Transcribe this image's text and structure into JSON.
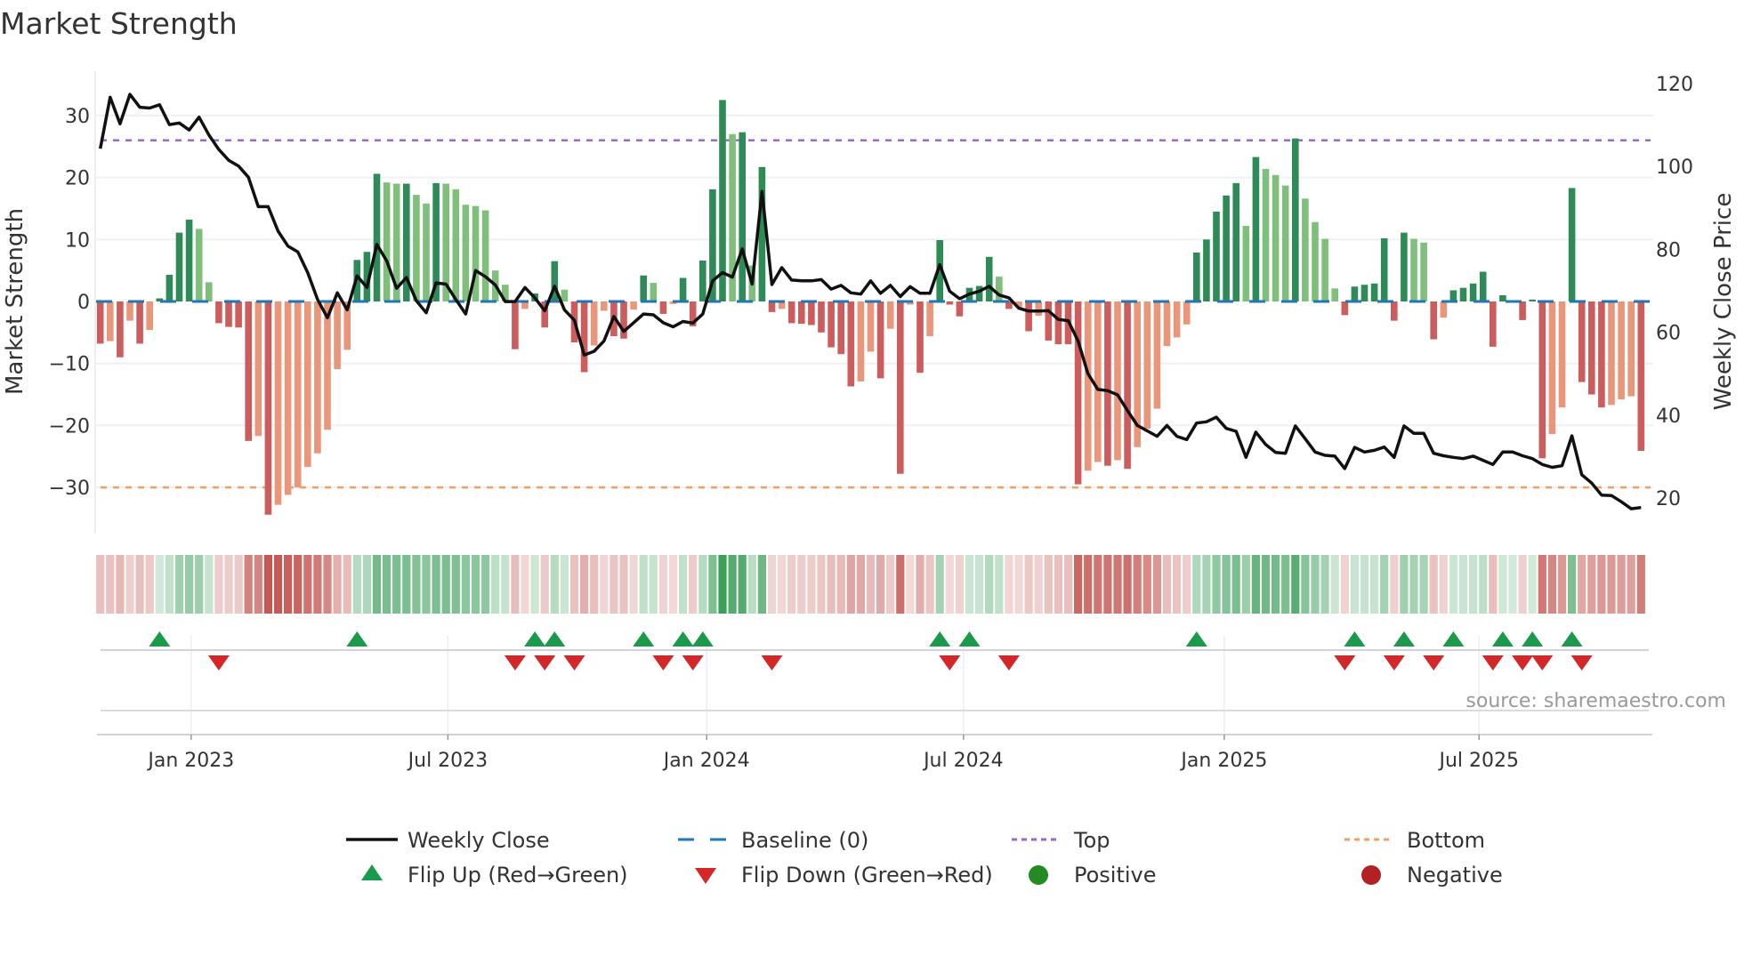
{
  "title": "Market Strength",
  "source": "source: sharemaestro.com",
  "colors": {
    "bar_pos_strong": "#2e8b57",
    "bar_pos_weak": "#7fbf7b",
    "bar_neg_strong": "#cd5c5c",
    "bar_neg_weak": "#e9967a",
    "line": "#111111",
    "baseline": "#1f77b4",
    "top": "#9966dd",
    "bottom": "#f0a060",
    "flip_up": "#1a9a4a",
    "flip_down": "#d62728",
    "positive": "#228b22",
    "negative": "#b22222",
    "strip_pos": "#3a9e58",
    "strip_neg": "#c55a55"
  },
  "legend": {
    "weekly_close": "Weekly Close",
    "baseline": "Baseline (0)",
    "top": "Top",
    "bottom": "Bottom",
    "flip_up": "Flip Up (Red→Green)",
    "flip_down": "Flip Down (Green→Red)",
    "positive": "Positive",
    "negative": "Negative"
  },
  "chart_data": {
    "type": "bar+line",
    "title": "Market Strength",
    "ylabel": "Market Strength",
    "y2label": "Weekly Close Price",
    "ylim": [
      -37,
      37
    ],
    "y2lim": [
      12,
      125
    ],
    "yticks": [
      30,
      20,
      10,
      0,
      -10,
      -20,
      -30
    ],
    "yticklabels": [
      "30",
      "20",
      "10",
      "0",
      "−10",
      "−20",
      "−30"
    ],
    "y2ticks": [
      120,
      100,
      80,
      60,
      40,
      20
    ],
    "xticklabels": [
      "Jan 2023",
      "Jul 2023",
      "Jan 2024",
      "Jul 2024",
      "Jan 2025",
      "Jul 2025"
    ],
    "xtick_week_index": [
      9.2,
      35.2,
      61.4,
      87.4,
      113.8,
      139.6
    ],
    "grid": true,
    "legend_position": "bottom",
    "top_line": 26,
    "bottom_line": -30,
    "baseline": 0,
    "strength": [
      -6.8,
      -6.4,
      -9.0,
      -3.1,
      -6.8,
      -4.6,
      0.5,
      4.3,
      11.1,
      13.2,
      11.7,
      3.1,
      -3.5,
      -4.1,
      -4.2,
      -22.5,
      -21.7,
      -34.4,
      -32.8,
      -31.2,
      -30.0,
      -26.7,
      -24.5,
      -20.7,
      -10.9,
      -7.8,
      6.7,
      8.0,
      20.6,
      19.2,
      19.0,
      19.0,
      17.2,
      15.8,
      19.1,
      19.0,
      18.1,
      15.6,
      15.4,
      14.7,
      5.0,
      2.7,
      -7.7,
      -1.2,
      1.3,
      -4.2,
      6.5,
      1.9,
      -6.6,
      -11.4,
      -7.1,
      -1.5,
      -5.6,
      -6.0,
      -1.3,
      4.2,
      3.0,
      -2.0,
      -0.4,
      3.8,
      -4.0,
      6.6,
      18.1,
      32.5,
      27.0,
      27.3,
      5.8,
      21.7,
      -1.7,
      -1.2,
      -3.5,
      -3.6,
      -3.8,
      -5.0,
      -7.4,
      -8.5,
      -13.7,
      -12.9,
      -8.1,
      -12.4,
      -4.4,
      -27.8,
      -0.5,
      -11.5,
      -5.6,
      9.9,
      -0.5,
      -2.4,
      2.2,
      2.5,
      7.2,
      4.0,
      -1.2,
      -0.9,
      -4.8,
      -2.3,
      -6.3,
      -6.9,
      -6.9,
      -29.5,
      -27.3,
      -25.9,
      -26.5,
      -25.6,
      -27.0,
      -23.5,
      -20.5,
      -17.3,
      -7.2,
      -5.8,
      -3.7,
      7.9,
      10.0,
      14.5,
      17.1,
      19.1,
      12.2,
      23.3,
      21.4,
      20.4,
      18.7,
      26.3,
      16.6,
      12.8,
      10.1,
      2.1,
      -2.2,
      2.4,
      2.7,
      2.9,
      10.2,
      -3.1,
      11.1,
      10.1,
      9.5,
      -6.1,
      -2.6,
      1.8,
      2.2,
      2.9,
      4.8,
      -7.3,
      1.0,
      0.2,
      -3.0,
      0.3,
      -25.3,
      -21.4,
      -17.1,
      18.3,
      -13.0,
      -15.0,
      -17.1,
      -16.7,
      -15.8,
      -15.3,
      -24.1
    ],
    "weekly_close": [
      104.3,
      116.7,
      110.3,
      117.4,
      114.3,
      114.1,
      114.9,
      110.1,
      110.5,
      108.8,
      111.9,
      107.6,
      104.1,
      101.5,
      100.1,
      97.4,
      90.3,
      90.3,
      84.4,
      80.8,
      79.4,
      74.4,
      67.9,
      63.5,
      69.5,
      65.4,
      73.6,
      70.8,
      81.2,
      77.2,
      70.6,
      73.2,
      67.6,
      64.7,
      71.9,
      71.6,
      67.9,
      64.4,
      74.9,
      73.4,
      71.4,
      67.4,
      67.4,
      70.8,
      68.3,
      65.2,
      71.1,
      65.4,
      62.9,
      54.5,
      55.4,
      57.9,
      63.8,
      60.2,
      62.3,
      64.4,
      64.2,
      62.3,
      61.3,
      62.6,
      62.2,
      64.4,
      72.4,
      74.4,
      73.3,
      80.1,
      71.6,
      94.0,
      71.5,
      75.6,
      72.6,
      72.4,
      72.4,
      72.7,
      70.4,
      71.3,
      69.5,
      69.2,
      72.4,
      69.4,
      71.3,
      68.6,
      71.0,
      69.4,
      69.4,
      76.3,
      69.9,
      68.1,
      69.2,
      69.9,
      71.1,
      69.0,
      68.3,
      65.8,
      65.1,
      65.1,
      65.2,
      63.1,
      62.8,
      57.9,
      50.0,
      46.2,
      45.9,
      44.9,
      41.1,
      37.5,
      36.2,
      34.9,
      37.5,
      34.9,
      34.1,
      38.1,
      38.4,
      39.5,
      36.8,
      36.1,
      29.8,
      35.9,
      32.9,
      31.0,
      30.8,
      37.4,
      34.3,
      31.1,
      30.3,
      30.1,
      27.1,
      32.2,
      31.1,
      31.5,
      32.3,
      29.8,
      37.4,
      35.6,
      35.6,
      30.8,
      30.2,
      29.8,
      29.5,
      30.1,
      29.1,
      28.1,
      31.1,
      31.1,
      30.2,
      29.5,
      28.1,
      27.4,
      27.8,
      35.0,
      25.6,
      23.6,
      20.7,
      20.6,
      19.1,
      17.4,
      17.7
    ]
  }
}
